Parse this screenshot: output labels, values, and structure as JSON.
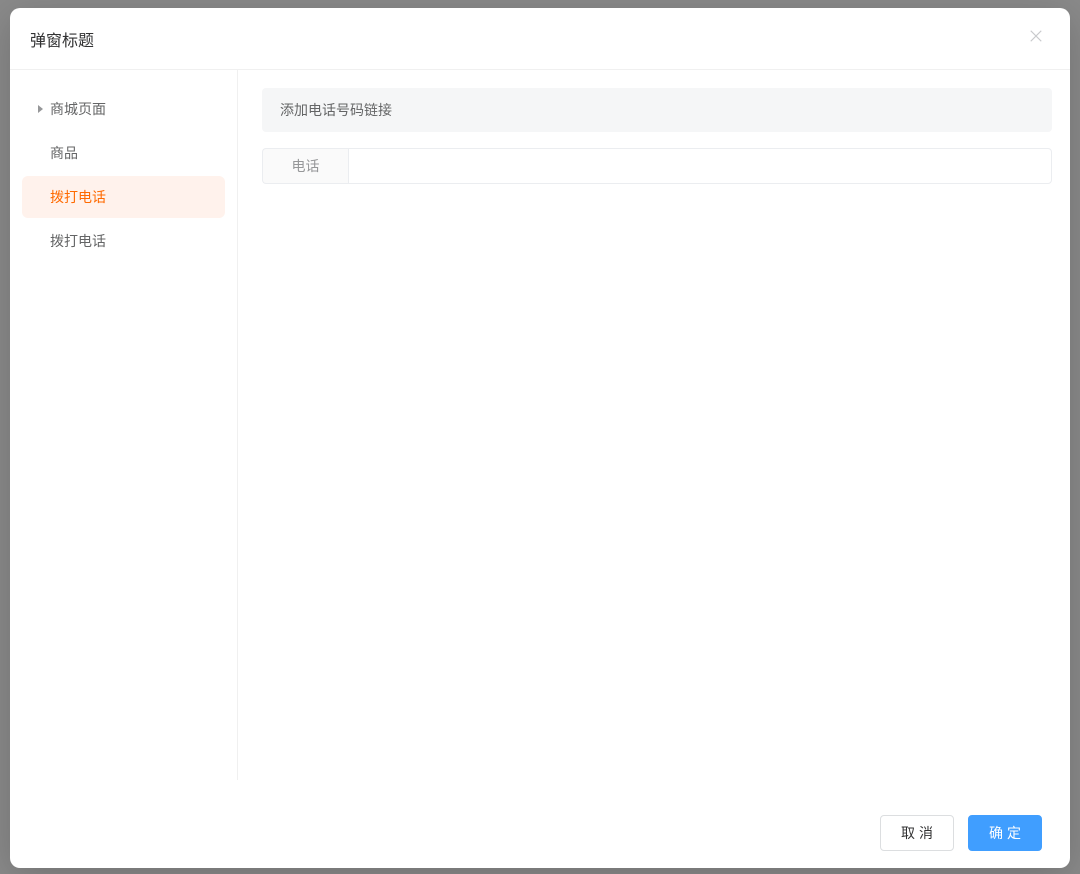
{
  "modal": {
    "title": "弹窗标题"
  },
  "sidebar": {
    "items": [
      {
        "label": "商城页面",
        "hasArrow": true,
        "active": false
      },
      {
        "label": "商品",
        "hasArrow": false,
        "active": false
      },
      {
        "label": "拨打电话",
        "hasArrow": false,
        "active": true
      },
      {
        "label": "拨打电话",
        "hasArrow": false,
        "active": false
      }
    ]
  },
  "content": {
    "info": "添加电话号码链接",
    "fieldLabel": "电话",
    "fieldValue": ""
  },
  "footer": {
    "cancel": "取消",
    "confirm": "确定"
  }
}
